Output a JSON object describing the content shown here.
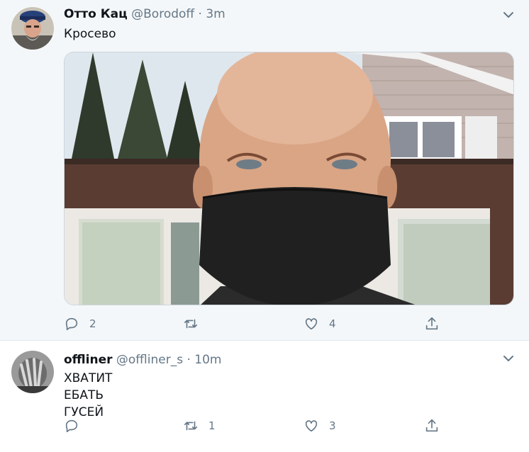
{
  "tweets": [
    {
      "author_name": "Отто Кац",
      "handle": "@Borodoff",
      "separator": "·",
      "time": "3m",
      "text_lines": [
        "Кросево"
      ],
      "reply_count": "2",
      "retweet_count": "",
      "like_count": "4"
    },
    {
      "author_name": "offliner",
      "handle": "@offliner_s",
      "separator": "·",
      "time": "10m",
      "text_lines": [
        "ХВАТИТ",
        "ЕБАТЬ",
        "ГУСЕЙ"
      ],
      "reply_count": "",
      "retweet_count": "1",
      "like_count": "3"
    }
  ],
  "icons": [
    "chevron-down-icon",
    "reply-icon",
    "retweet-icon",
    "like-icon",
    "share-icon"
  ]
}
